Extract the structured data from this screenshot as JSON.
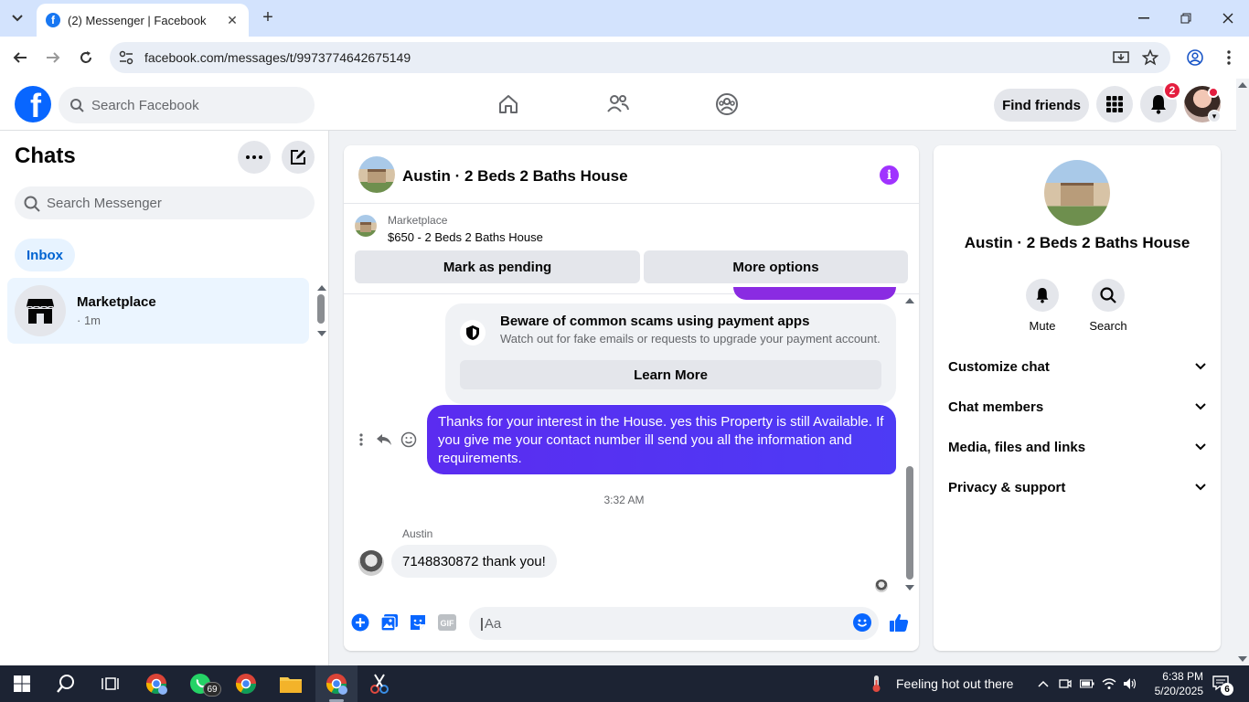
{
  "browser": {
    "tab_title": "(2) Messenger | Facebook",
    "tab_favicon": "facebook-favicon-icon",
    "url": "facebook.com/messages/t/9973774642675149"
  },
  "fb_header": {
    "search_placeholder": "Search Facebook",
    "find_friends_label": "Find friends",
    "notification_count": "2"
  },
  "chats": {
    "title": "Chats",
    "search_placeholder": "Search Messenger",
    "filter_label": "Inbox",
    "items": [
      {
        "name": "Marketplace",
        "meta": "· 1m"
      }
    ]
  },
  "conversation": {
    "title": "Austin · 2 Beds 2 Baths House",
    "marketplace_label": "Marketplace",
    "listing": "$650 - 2 Beds 2 Baths House",
    "mark_pending_label": "Mark as pending",
    "more_options_label": "More options",
    "scam_title": "Beware of common scams using payment apps",
    "scam_subtitle": "Watch out for fake emails or requests to upgrade your payment account.",
    "learn_more_label": "Learn More",
    "outgoing_message": "Thanks for your interest in the House. yes this Property is still Available. If you give me your contact number ill send you all the information and requirements.",
    "timestamp": "3:32 AM",
    "incoming_sender": "Austin",
    "incoming_message": "7148830872 thank you!",
    "composer_placeholder": "Aa"
  },
  "info_panel": {
    "title": "Austin · 2 Beds 2 Baths House",
    "mute_label": "Mute",
    "search_label": "Search",
    "sections": [
      "Customize chat",
      "Chat members",
      "Media, files and links",
      "Privacy & support"
    ]
  },
  "taskbar": {
    "whatsapp_badge": "69",
    "weather_text": "Feeling hot out there",
    "time": "6:38 PM",
    "date": "5/20/2025",
    "notification_count": "6"
  },
  "colors": {
    "fb_blue": "#0866ff",
    "outgoing_bubble": "#5b2cf0",
    "badge_red": "#e41e3f",
    "info_purple": "#a033ff"
  }
}
